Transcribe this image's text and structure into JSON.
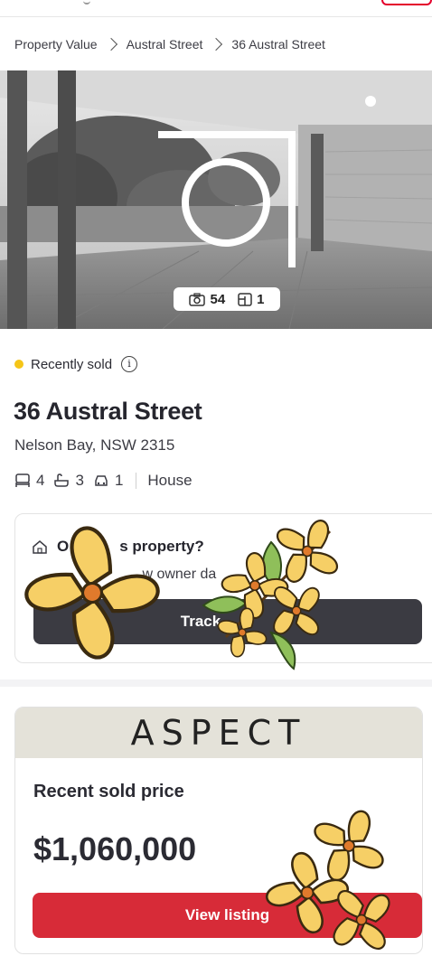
{
  "breadcrumb": {
    "items": [
      "Property Value",
      "Austral Street",
      "36 Austral Street"
    ]
  },
  "hero": {
    "photo_count": "54",
    "floorplan_count": "1",
    "camera_icon": "camera-icon",
    "floorplan_icon": "floorplan-icon"
  },
  "status": {
    "label": "Recently sold",
    "dot_color": "#f5c518"
  },
  "property": {
    "address": "36 Austral Street",
    "suburb": "Nelson Bay, NSW 2315",
    "beds": "4",
    "baths": "3",
    "cars": "1",
    "type": "House"
  },
  "owner_card": {
    "question": "O",
    "question_tail": "s property?",
    "desc_head": "",
    "desc_mid": "w owner da",
    "desc_tail": "ts.",
    "track_label": "Track"
  },
  "ad": {
    "brand": "ASPECT",
    "label": "Recent sold price",
    "price": "$1,060,000",
    "button": "View listing",
    "button_color": "#d72b38"
  }
}
